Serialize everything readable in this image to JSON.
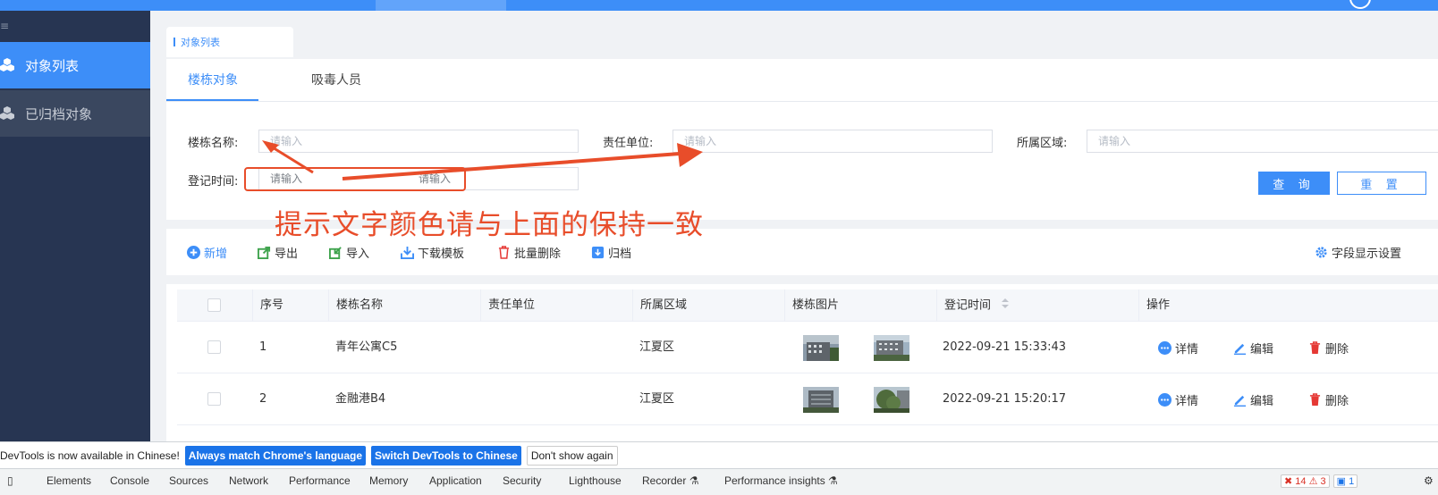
{
  "sidebar": {
    "items": [
      {
        "label": "对象列表",
        "icon": "cube-stack-icon",
        "active": true
      },
      {
        "label": "已归档对象",
        "icon": "cube-stack-icon",
        "active": false
      }
    ]
  },
  "breadcrumb": {
    "label": "对象列表"
  },
  "tabs": [
    {
      "label": "楼栋对象",
      "active": true
    },
    {
      "label": "吸毒人员",
      "active": false
    }
  ],
  "filters": {
    "building_name": {
      "label": "楼栋名称:",
      "placeholder": "请输入"
    },
    "responsible_unit": {
      "label": "责任单位:",
      "placeholder": "请输入"
    },
    "region": {
      "label": "所属区域:",
      "placeholder": "请输入"
    },
    "register_time": {
      "label": "登记时间:",
      "start_placeholder": "请输入",
      "end_placeholder": "请输入"
    },
    "query_label": "查 询",
    "reset_label": "重 置"
  },
  "annotation": {
    "text": "提示文字颜色请与上面的保持一致",
    "color": "#e84d2a"
  },
  "toolbar": {
    "add": "新增",
    "export": "导出",
    "import": "导入",
    "template": "下载模板",
    "batch_delete": "批量删除",
    "archive": "归档",
    "field_settings": "字段显示设置"
  },
  "table": {
    "columns": [
      "序号",
      "楼栋名称",
      "责任单位",
      "所属区域",
      "楼栋图片",
      "登记时间",
      "操作"
    ],
    "rows": [
      {
        "index": "1",
        "name": "青年公寓C5",
        "unit": "",
        "region": "江夏区",
        "time": "2022-09-21 15:33:43"
      },
      {
        "index": "2",
        "name": "金融港B4",
        "unit": "",
        "region": "江夏区",
        "time": "2022-09-21 15:20:17"
      }
    ],
    "actions": {
      "detail": "详情",
      "edit": "编辑",
      "delete": "删除"
    }
  },
  "devtools": {
    "banner_message": "DevTools is now available in Chinese!",
    "btn_match": "Always match Chrome's language",
    "btn_switch": "Switch DevTools to Chinese",
    "btn_dismiss": "Don't show again",
    "tabs": [
      "Elements",
      "Console",
      "Sources",
      "Network",
      "Performance",
      "Memory",
      "Application",
      "Security",
      "Lighthouse",
      "Recorder ⚗",
      "Performance insights ⚗"
    ],
    "errors": "14",
    "warnings": "3",
    "issues": "1"
  },
  "colors": {
    "accent": "#3d8ef8",
    "sidebar": "#273552",
    "danger": "#e84d2a",
    "delete_icon": "#e53935"
  }
}
